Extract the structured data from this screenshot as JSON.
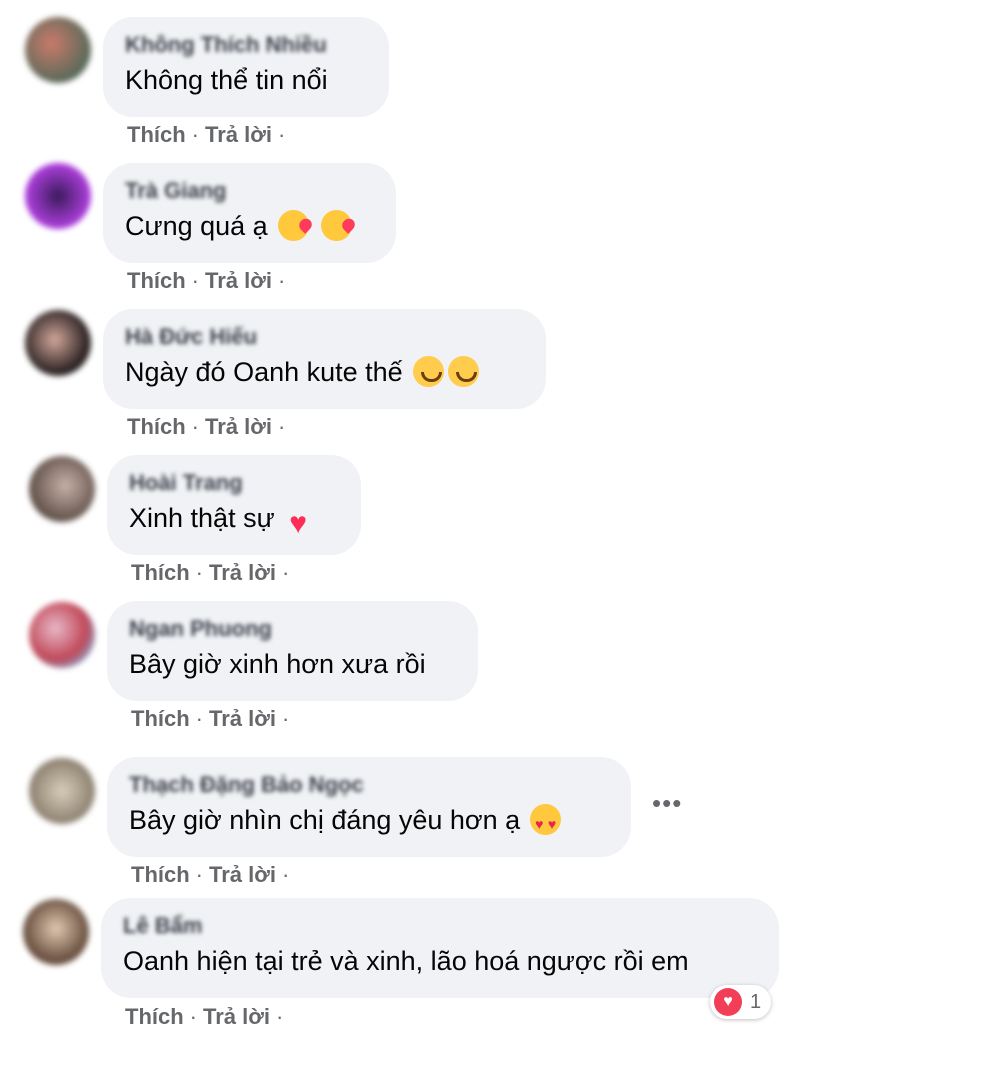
{
  "comments": [
    {
      "author": "Không Thích Nhiều",
      "text": "Không thể tin nổi",
      "emojis": [],
      "like": "Thích",
      "reply": "Trả lời"
    },
    {
      "author": "Trà Giang",
      "text": "Cưng quá ạ",
      "emojis": [
        "kiss-emoji",
        "kiss-emoji"
      ],
      "like": "Thích",
      "reply": "Trả lời"
    },
    {
      "author": "Hà Đức Hiếu",
      "text": "Ngày đó Oanh kute thế",
      "emojis": [
        "smile-emoji",
        "smile-emoji"
      ],
      "like": "Thích",
      "reply": "Trả lời"
    },
    {
      "author": "Hoài Trang",
      "text": "Xinh thật sự",
      "emojis": [
        "sparkling-heart-emoji"
      ],
      "like": "Thích",
      "reply": "Trả lời"
    },
    {
      "author": "Ngan Phuong",
      "text": "Bây giờ xinh hơn xưa rồi",
      "emojis": [],
      "like": "Thích",
      "reply": "Trả lời"
    },
    {
      "author": "Thạch Đặng Bảo Ngọc",
      "text": "Bây giờ nhìn chị đáng yêu hơn ạ",
      "emojis": [
        "heart-eyes-emoji"
      ],
      "like": "Thích",
      "reply": "Trả lời"
    },
    {
      "author": "Lê Bẩm",
      "text": "Oanh hiện tại trẻ và xinh, lão hoá ngược rồi em",
      "emojis": [],
      "like": "Thích",
      "reply": "Trả lời",
      "reaction_count": "1"
    }
  ],
  "separator": "·",
  "more_icon": "more-options-icon",
  "colors": {
    "bubble": "#f0f2f5",
    "action_text": "#65676b",
    "love_reaction": "#f33e58"
  }
}
